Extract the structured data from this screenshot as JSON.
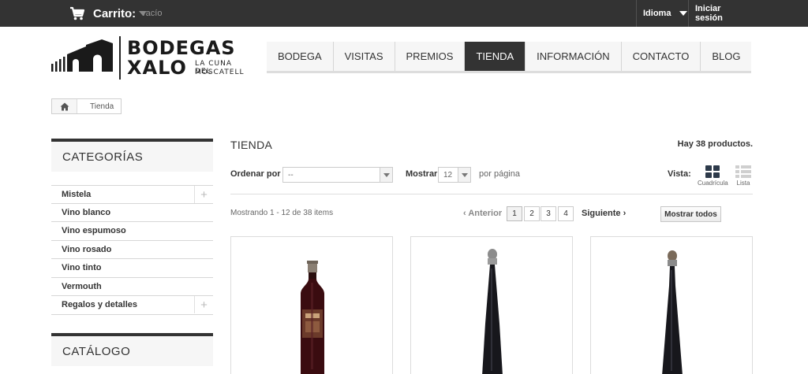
{
  "topbar": {
    "cart_label": "Carrito:",
    "cart_state": "vacío",
    "language_label": "Idioma",
    "login_label": "Iniciar sesión"
  },
  "logo": {
    "line1": "BODEGAS",
    "line2": "XALO",
    "tagline1": "LA CUNA DEL",
    "tagline2": "MOSCATELL"
  },
  "nav": {
    "items": [
      "BODEGA",
      "VISITAS",
      "PREMIOS",
      "TIENDA",
      "INFORMACIÓN",
      "CONTACTO",
      "BLOG"
    ],
    "active": "TIENDA"
  },
  "breadcrumb": {
    "current": "Tienda"
  },
  "sidebar": {
    "categories_title": "CATEGORÍAS",
    "categories": [
      {
        "label": "Mistela",
        "expandable": true
      },
      {
        "label": "Vino blanco",
        "expandable": false
      },
      {
        "label": "Vino espumoso",
        "expandable": false
      },
      {
        "label": "Vino rosado",
        "expandable": false
      },
      {
        "label": "Vino tinto",
        "expandable": false
      },
      {
        "label": "Vermouth",
        "expandable": false
      },
      {
        "label": "Regalos y detalles",
        "expandable": true
      }
    ],
    "expand_symbol": "+",
    "catalog_title": "CATÁLOGO"
  },
  "listing": {
    "heading": "TIENDA",
    "count_text": "Hay 38 productos.",
    "sort_label": "Ordenar por",
    "sort_value": "--",
    "show_label": "Mostrar",
    "show_value": "12",
    "per_page_label": "por página",
    "view_label": "Vista:",
    "view_grid_label": "Cuadrícula",
    "view_list_label": "Lista",
    "showing_text": "Mostrando 1 - 12 de 38 items",
    "prev_label": "Anterior",
    "pages": [
      "1",
      "2",
      "3",
      "4"
    ],
    "current_page": "1",
    "next_label": "Siguiente",
    "show_all_label": "Mostrar todos"
  },
  "colors": {
    "topbar": "#333333",
    "nav_active": "#333333",
    "nav_background": "#f6f6f6",
    "bottle_dark": "#1b1b1f"
  },
  "icons": [
    "cart-icon",
    "chevron-down-icon",
    "home-icon",
    "plus-icon",
    "grid-view-icon",
    "list-view-icon",
    "chevron-left-icon",
    "chevron-right-icon"
  ]
}
